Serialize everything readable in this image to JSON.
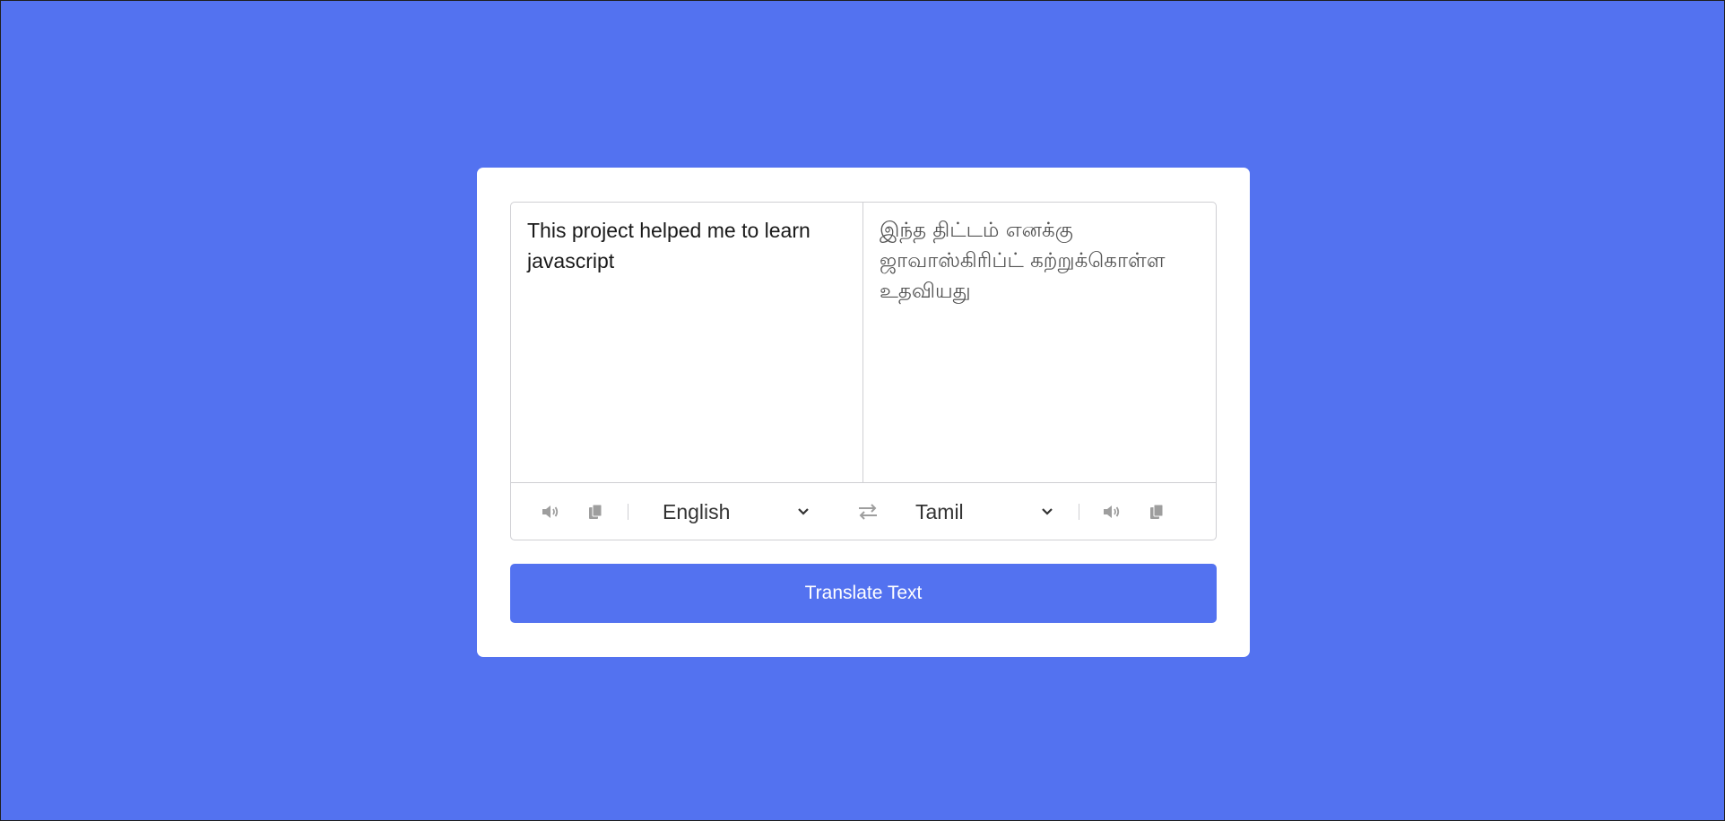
{
  "colors": {
    "background": "#5372F0",
    "accent": "#5372F0",
    "card": "#ffffff",
    "icon": "#9e9e9e"
  },
  "translator": {
    "from_text": "This project helped me to learn javascript",
    "to_text": "இந்த திட்டம் எனக்கு ஜாவாஸ்கிரிப்ட் கற்றுக்கொள்ள உதவியது",
    "from_language": "English",
    "to_language": "Tamil",
    "translate_label": "Translate Text"
  },
  "icons": {
    "speak": "volume-icon",
    "copy": "copy-icon",
    "exchange": "exchange-icon",
    "dropdown": "chevron-down-icon"
  }
}
